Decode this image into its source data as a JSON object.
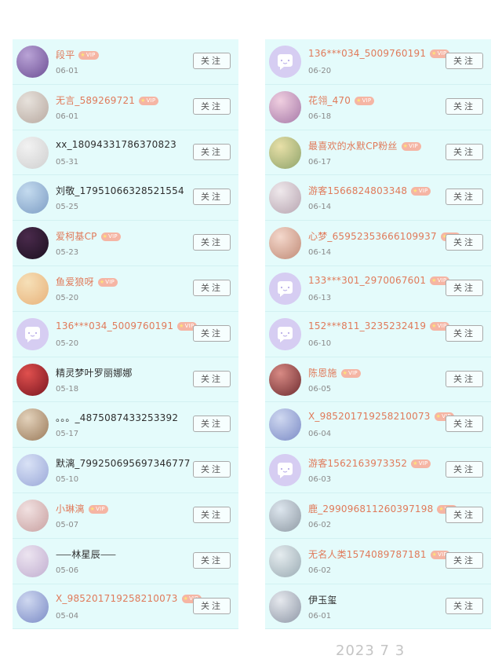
{
  "follow_label": "关注",
  "vip_label": "VIP",
  "left_list": [
    {
      "name": "段平",
      "date": "06-01",
      "vip": true,
      "color": "accent",
      "avatar": {
        "type": "photo",
        "colors": [
          "#b9a3d6",
          "#6d4f95"
        ]
      }
    },
    {
      "name": "无言_589269721",
      "date": "06-01",
      "vip": true,
      "color": "accent",
      "avatar": {
        "type": "photo",
        "colors": [
          "#e7e2dc",
          "#b8a9a0"
        ]
      }
    },
    {
      "name": "xx_18094331786370823",
      "date": "05-31",
      "vip": false,
      "color": "dark",
      "avatar": {
        "type": "photo",
        "colors": [
          "#f2f2f2",
          "#cfcfcf"
        ]
      }
    },
    {
      "name": "刘敬_17951066328521554",
      "date": "05-25",
      "vip": false,
      "color": "dark",
      "avatar": {
        "type": "photo",
        "colors": [
          "#c4dbef",
          "#7d9dc4"
        ]
      }
    },
    {
      "name": "爱柯基CP",
      "date": "05-23",
      "vip": true,
      "color": "accent",
      "avatar": {
        "type": "photo",
        "colors": [
          "#4a2a4c",
          "#1c1020"
        ]
      }
    },
    {
      "name": "鱼爱狼呀",
      "date": "05-20",
      "vip": true,
      "color": "accent",
      "avatar": {
        "type": "photo",
        "colors": [
          "#f6e0b8",
          "#e8b27a"
        ]
      }
    },
    {
      "name": "136***034_5009760191",
      "date": "05-20",
      "vip": true,
      "color": "accent",
      "avatar": {
        "type": "bubble"
      }
    },
    {
      "name": "精灵梦叶罗丽娜娜",
      "date": "05-18",
      "vip": false,
      "color": "dark",
      "avatar": {
        "type": "photo",
        "colors": [
          "#e0504e",
          "#7a1620"
        ]
      }
    },
    {
      "name": "。。。_4875087433253392",
      "date": "05-17",
      "vip": false,
      "color": "dark",
      "avatar": {
        "type": "photo",
        "colors": [
          "#e3d2bb",
          "#9a7a5a"
        ]
      }
    },
    {
      "name": "默漓_799250695697346777",
      "date": "05-10",
      "vip": false,
      "color": "dark",
      "avatar": {
        "type": "photo",
        "colors": [
          "#d9e2f6",
          "#9aa8d8"
        ]
      }
    },
    {
      "name": "小琳漓",
      "date": "05-07",
      "vip": true,
      "color": "accent",
      "avatar": {
        "type": "photo",
        "colors": [
          "#f1e1e1",
          "#c8a0a0"
        ]
      }
    },
    {
      "name": "⸺林星辰⸺",
      "date": "05-06",
      "vip": false,
      "color": "dark",
      "avatar": {
        "type": "photo",
        "colors": [
          "#ece4f0",
          "#c1aed0"
        ]
      }
    },
    {
      "name": "X_985201719258210073",
      "date": "05-04",
      "vip": true,
      "color": "accent",
      "avatar": {
        "type": "photo",
        "colors": [
          "#cfd8f0",
          "#7b8bc6"
        ]
      }
    }
  ],
  "right_list": [
    {
      "name": "136***034_5009760191",
      "date": "06-20",
      "vip": true,
      "color": "accent",
      "avatar": {
        "type": "bubble"
      }
    },
    {
      "name": "花翎_470",
      "date": "06-18",
      "vip": true,
      "color": "accent",
      "avatar": {
        "type": "photo",
        "colors": [
          "#f0cfe0",
          "#a679a8"
        ]
      }
    },
    {
      "name": "最喜欢的水默CP粉丝",
      "date": "06-17",
      "vip": true,
      "color": "accent",
      "avatar": {
        "type": "photo",
        "colors": [
          "#e8e0a8",
          "#8ea36a"
        ]
      }
    },
    {
      "name": "游客1566824803348",
      "date": "06-14",
      "vip": true,
      "color": "accent",
      "avatar": {
        "type": "photo",
        "colors": [
          "#efe9ec",
          "#b7a4b0"
        ]
      }
    },
    {
      "name": "心梦_65952353666109937",
      "date": "06-14",
      "vip": true,
      "color": "accent",
      "avatar": {
        "type": "photo",
        "colors": [
          "#f4d8cc",
          "#c08a76"
        ]
      }
    },
    {
      "name": "133***301_2970067601",
      "date": "06-13",
      "vip": true,
      "color": "accent",
      "avatar": {
        "type": "bubble"
      }
    },
    {
      "name": "152***811_3235232419",
      "date": "06-10",
      "vip": true,
      "color": "accent",
      "avatar": {
        "type": "bubble"
      }
    },
    {
      "name": "陈恩施",
      "date": "06-05",
      "vip": true,
      "color": "accent",
      "avatar": {
        "type": "photo",
        "colors": [
          "#d88a84",
          "#6e2c30"
        ]
      }
    },
    {
      "name": "X_985201719258210073",
      "date": "06-04",
      "vip": true,
      "color": "accent",
      "avatar": {
        "type": "photo",
        "colors": [
          "#cfd8f0",
          "#7b8bc6"
        ]
      }
    },
    {
      "name": "游客1562163973352",
      "date": "06-03",
      "vip": true,
      "color": "accent",
      "avatar": {
        "type": "bubble"
      }
    },
    {
      "name": "鹿_299096811260397198",
      "date": "06-02",
      "vip": true,
      "color": "accent",
      "avatar": {
        "type": "photo",
        "colors": [
          "#dde6ee",
          "#8f9aa4"
        ]
      }
    },
    {
      "name": "无名人类1574089787181",
      "date": "06-02",
      "vip": true,
      "color": "accent",
      "avatar": {
        "type": "photo",
        "colors": [
          "#e5ecef",
          "#9aabb3"
        ]
      }
    },
    {
      "name": "伊玉玺",
      "date": "06-01",
      "vip": false,
      "color": "dark",
      "avatar": {
        "type": "photo",
        "colors": [
          "#e6e9ee",
          "#8e97a6"
        ]
      }
    }
  ],
  "stamp": "2023 7 3"
}
